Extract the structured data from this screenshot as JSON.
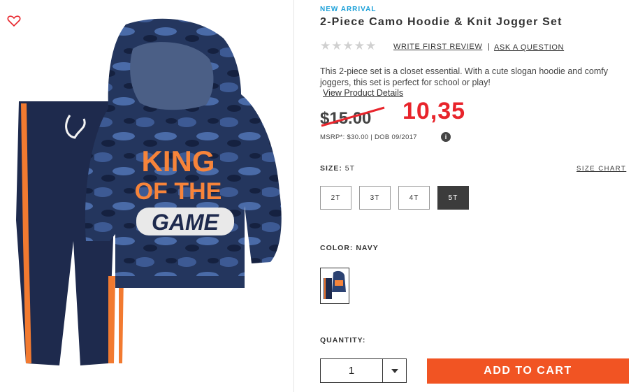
{
  "product": {
    "badge": "NEW ARRIVAL",
    "title": "2-Piece Camo Hoodie & Knit Jogger Set",
    "rating_stars": 5,
    "rating_value": 0,
    "write_review": "WRITE FIRST REVIEW",
    "separator": "|",
    "ask_question": "ASK A QUESTION",
    "description": "This 2-piece set is a closet essential. With a cute slogan hoodie and comfy joggers, this set is perfect for school or play!",
    "details_link": "View Product Details",
    "hoodie_text": [
      "KING",
      "OF THE",
      "GAME"
    ]
  },
  "price": {
    "current": "$15.00",
    "handwritten_price": "10,35",
    "msrp_line": "MSRP*: $30.00  |  DOB 09/2017",
    "info_icon": "i"
  },
  "size": {
    "label": "SIZE:",
    "selected": "5T",
    "chart_link": "SIZE CHART",
    "options": [
      "2T",
      "3T",
      "4T",
      "5T"
    ]
  },
  "color": {
    "label": "COLOR: NAVY"
  },
  "quantity": {
    "label": "QUANTITY:",
    "value": "1"
  },
  "cart": {
    "button": "ADD TO CART"
  },
  "colors": {
    "accent_blue": "#1ba0d8",
    "cart_orange": "#f15423",
    "handwritten_red": "#e8242b",
    "heart": "#e8242b",
    "navy": "#1c2a4a",
    "orange_text": "#f7843a"
  },
  "icons": [
    "heart-icon",
    "star-icon",
    "info-icon",
    "chevron-down-icon"
  ]
}
